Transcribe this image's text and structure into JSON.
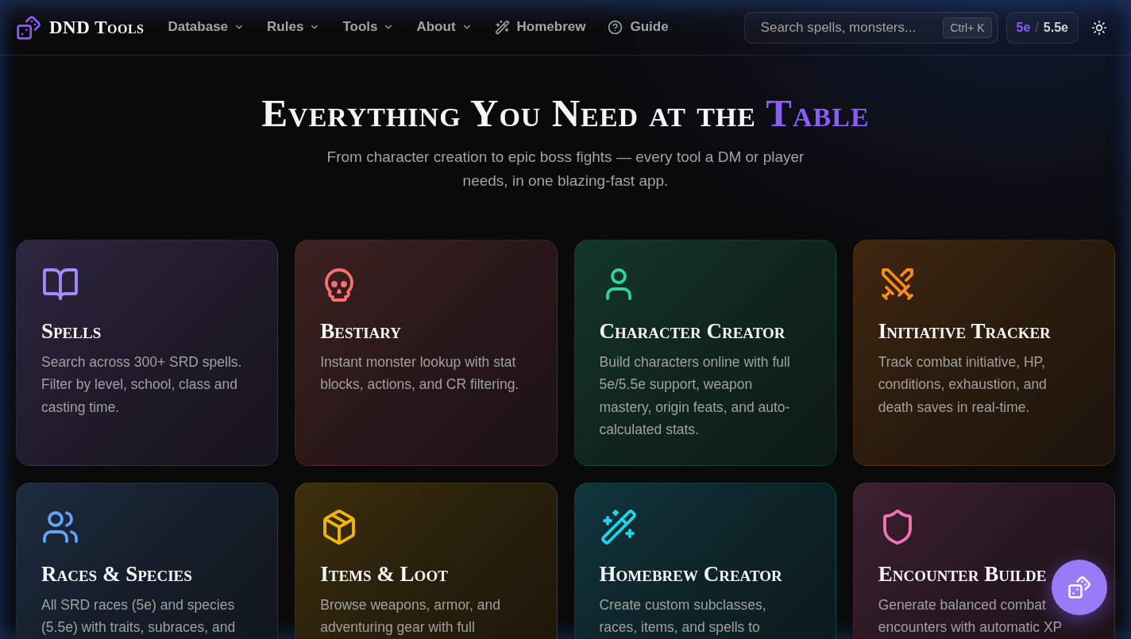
{
  "header": {
    "brand": "DND Tools",
    "nav": [
      {
        "label": "Database",
        "kind": "dropdown"
      },
      {
        "label": "Rules",
        "kind": "dropdown"
      },
      {
        "label": "Tools",
        "kind": "dropdown"
      },
      {
        "label": "About",
        "kind": "dropdown"
      },
      {
        "label": "Homebrew",
        "kind": "link"
      },
      {
        "label": "Guide",
        "kind": "link"
      }
    ],
    "search": {
      "placeholder": "Search spells, monsters...",
      "shortcut": "Ctrl+ K"
    },
    "version_toggle": {
      "options": [
        {
          "label": "5e",
          "selected": true
        },
        {
          "label": "5.5e",
          "selected": false
        }
      ],
      "separator": "/"
    }
  },
  "hero": {
    "title": "Everything You Need at the",
    "title_accent": "Table",
    "subtitle": "From character creation to epic boss fights — every tool a DM or player needs, in one blazing-fast app."
  },
  "cards": [
    {
      "title": "Spells",
      "description": "Search across 300+ SRD spells. Filter by level, school, class and casting time.",
      "color": "#a78bfa"
    },
    {
      "title": "Bestiary",
      "description": "Instant monster lookup with stat blocks, actions, and CR filtering.",
      "color": "#f87171"
    },
    {
      "title": "Character Creator",
      "description": "Build characters online with full 5e/5.5e support, weapon mastery, origin feats, and auto-calculated stats.",
      "color": "#34d399"
    },
    {
      "title": "Initiative Tracker",
      "description": "Track combat initiative, HP, conditions, exhaustion, and death saves in real-time.",
      "color": "#fb8a1c"
    },
    {
      "title": "Races & Species",
      "description": "All SRD races (5e) and species (5.5e) with traits, subraces, and",
      "color": "#60a5fa"
    },
    {
      "title": "Items & Loot",
      "description": "Browse weapons, armor, and adventuring gear with full",
      "color": "#f5b40b"
    },
    {
      "title": "Homebrew Creator",
      "description": "Create custom subclasses, races, items, and spells to",
      "color": "#22d3ee"
    },
    {
      "title": "Encounter Builde",
      "description": "Generate balanced combat encounters with automatic XP",
      "color": "#f472b6"
    }
  ]
}
